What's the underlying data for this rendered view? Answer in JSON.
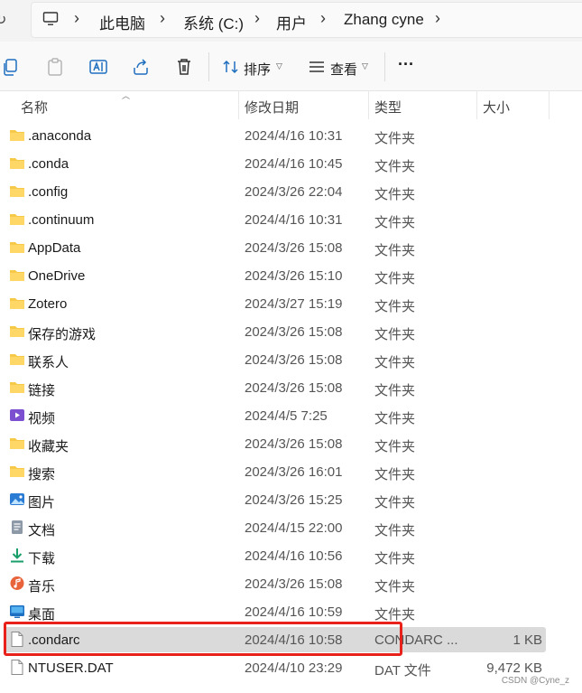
{
  "address_bar": {
    "crumbs": [
      "此电脑",
      "系统 (C:)",
      "用户",
      "Zhang cyne"
    ]
  },
  "toolbar": {
    "sort_label": "排序",
    "view_label": "查看",
    "more_label": "···"
  },
  "columns": {
    "name": "名称",
    "modified": "修改日期",
    "type": "类型",
    "size": "大小"
  },
  "rows": [
    {
      "name": ".anaconda",
      "date": "2024/4/16 10:31",
      "type": "文件夹",
      "size": "",
      "icon": "folder-icon"
    },
    {
      "name": ".conda",
      "date": "2024/4/16 10:45",
      "type": "文件夹",
      "size": "",
      "icon": "folder-icon"
    },
    {
      "name": ".config",
      "date": "2024/3/26 22:04",
      "type": "文件夹",
      "size": "",
      "icon": "folder-icon"
    },
    {
      "name": ".continuum",
      "date": "2024/4/16 10:31",
      "type": "文件夹",
      "size": "",
      "icon": "folder-icon"
    },
    {
      "name": "AppData",
      "date": "2024/3/26 15:08",
      "type": "文件夹",
      "size": "",
      "icon": "folder-icon"
    },
    {
      "name": "OneDrive",
      "date": "2024/3/26 15:10",
      "type": "文件夹",
      "size": "",
      "icon": "folder-icon"
    },
    {
      "name": "Zotero",
      "date": "2024/3/27 15:19",
      "type": "文件夹",
      "size": "",
      "icon": "folder-icon"
    },
    {
      "name": "保存的游戏",
      "date": "2024/3/26 15:08",
      "type": "文件夹",
      "size": "",
      "icon": "folder-icon"
    },
    {
      "name": "联系人",
      "date": "2024/3/26 15:08",
      "type": "文件夹",
      "size": "",
      "icon": "folder-icon"
    },
    {
      "name": "链接",
      "date": "2024/3/26 15:08",
      "type": "文件夹",
      "size": "",
      "icon": "folder-icon"
    },
    {
      "name": "视频",
      "date": "2024/4/5 7:25",
      "type": "文件夹",
      "size": "",
      "icon": "video-folder-icon"
    },
    {
      "name": "收藏夹",
      "date": "2024/3/26 15:08",
      "type": "文件夹",
      "size": "",
      "icon": "folder-icon"
    },
    {
      "name": "搜索",
      "date": "2024/3/26 16:01",
      "type": "文件夹",
      "size": "",
      "icon": "folder-icon"
    },
    {
      "name": "图片",
      "date": "2024/3/26 15:25",
      "type": "文件夹",
      "size": "",
      "icon": "pictures-folder-icon"
    },
    {
      "name": "文档",
      "date": "2024/4/15 22:00",
      "type": "文件夹",
      "size": "",
      "icon": "documents-folder-icon"
    },
    {
      "name": "下载",
      "date": "2024/4/16 10:56",
      "type": "文件夹",
      "size": "",
      "icon": "download-folder-icon"
    },
    {
      "name": "音乐",
      "date": "2024/3/26 15:08",
      "type": "文件夹",
      "size": "",
      "icon": "music-folder-icon"
    },
    {
      "name": "桌面",
      "date": "2024/4/16 10:59",
      "type": "文件夹",
      "size": "",
      "icon": "desktop-folder-icon"
    },
    {
      "name": ".condarc",
      "date": "2024/4/16 10:58",
      "type": "CONDARC ...",
      "size": "1 KB",
      "icon": "file-icon",
      "selected": true
    },
    {
      "name": "NTUSER.DAT",
      "date": "2024/4/10 23:29",
      "type": "DAT 文件",
      "size": "9,472 KB",
      "icon": "file-icon"
    }
  ],
  "watermark": "CSDN @Cyne_z",
  "colors": {
    "folder": "#f7c948",
    "selection": "#dadada",
    "highlight_border": "#e8211b"
  }
}
